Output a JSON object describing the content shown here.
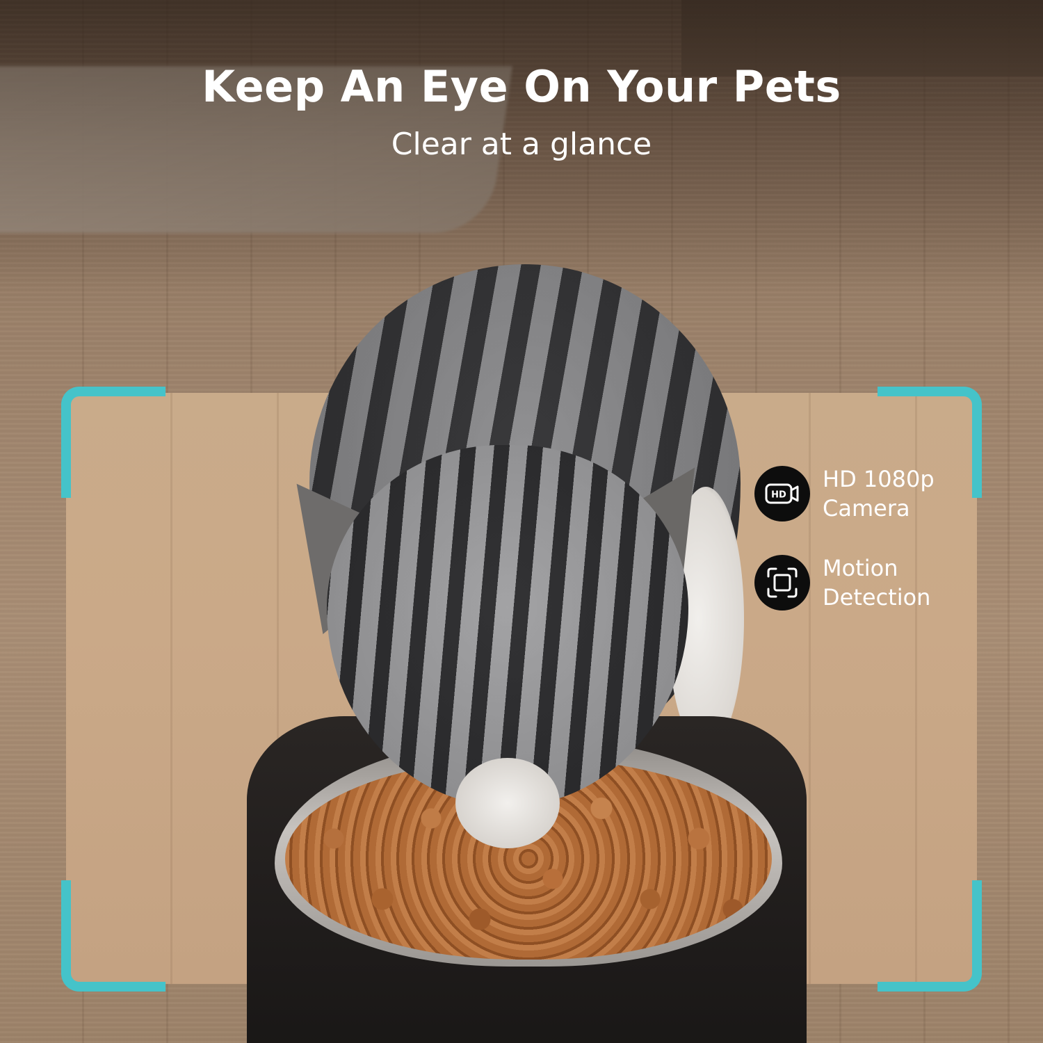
{
  "header": {
    "title": "Keep An Eye On Your Pets",
    "subtitle": "Clear at a glance"
  },
  "features": [
    {
      "icon": "hd-camera-icon",
      "line1": "HD 1080p",
      "line2": "Camera"
    },
    {
      "icon": "motion-detection-icon",
      "line1": "Motion",
      "line2": "Detection"
    }
  ],
  "colors": {
    "accent": "#45c3c9",
    "icon_background": "#0d0d0d",
    "text": "#ffffff"
  }
}
